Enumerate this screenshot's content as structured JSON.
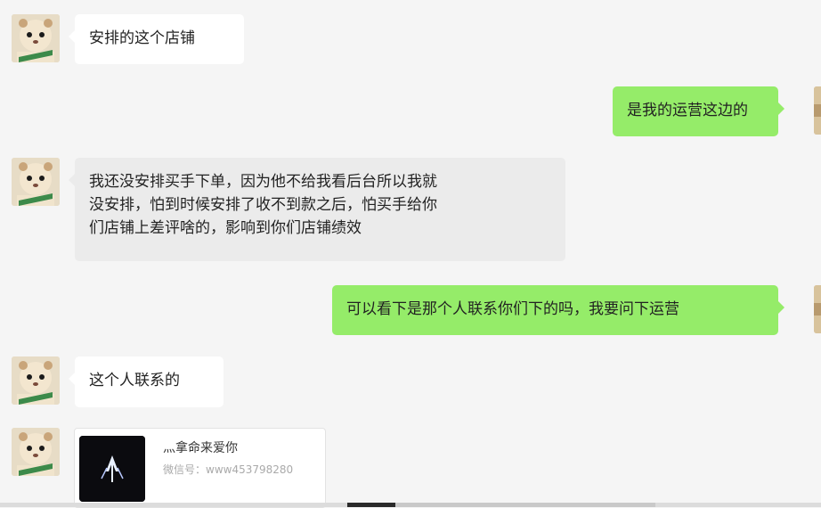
{
  "messages": [
    {
      "side": "left",
      "text": "安排的这个店铺"
    },
    {
      "side": "right",
      "text": "是我的运营这边的"
    },
    {
      "side": "left",
      "lines": [
        "我还没安排买手下单，因为他不给我看后台所以我就",
        "没安排，怕到时候安排了收不到款之后，怕买手给你",
        "们店铺上差评啥的，影响到你们店铺绩效"
      ]
    },
    {
      "side": "right",
      "text": "可以看下是那个人联系你们下的吗，我要问下运营"
    },
    {
      "side": "left",
      "text": "这个人联系的"
    }
  ],
  "contact_card": {
    "name": "灬拿命来爱你",
    "wechat_id": "微信号：www453798280"
  }
}
